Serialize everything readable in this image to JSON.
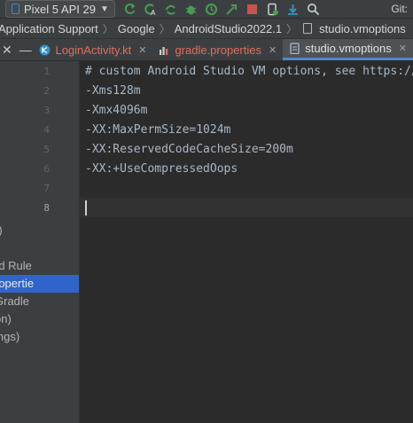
{
  "toolbar": {
    "device_selector": "Pixel 5 API 29",
    "git_label": "Git:"
  },
  "breadcrumb": [
    "Application Support",
    "Google",
    "AndroidStudio2022.1",
    "studio.vmoptions"
  ],
  "tabs": [
    {
      "label": "LoginActivity.kt",
      "active": false,
      "icon": "kotlin-file-icon"
    },
    {
      "label": "gradle.properties",
      "active": false,
      "icon": "gradle-file-icon"
    },
    {
      "label": "studio.vmoptions",
      "active": true,
      "icon": "settings-file-icon"
    }
  ],
  "project_panel": {
    "items": [
      "r)",
      "rd Rule",
      "ropertie",
      "Gradle",
      "on)",
      "ings)"
    ],
    "selected_index": 2
  },
  "editor": {
    "lines": [
      {
        "num": "1",
        "text": "# custom Android Studio VM options, see https://"
      },
      {
        "num": "2",
        "text": "-Xms128m"
      },
      {
        "num": "3",
        "text": "-Xmx4096m"
      },
      {
        "num": "4",
        "text": "-XX:MaxPermSize=1024m"
      },
      {
        "num": "5",
        "text": "-XX:ReservedCodeCacheSize=200m"
      },
      {
        "num": "6",
        "text": "-XX:+UseCompressedOops"
      },
      {
        "num": "7",
        "text": ""
      },
      {
        "num": "8",
        "text": ""
      }
    ],
    "current_line": 8
  },
  "colors": {
    "selection": "#2f65ca",
    "accent": "#4a88c7",
    "run_green": "#499c54"
  }
}
